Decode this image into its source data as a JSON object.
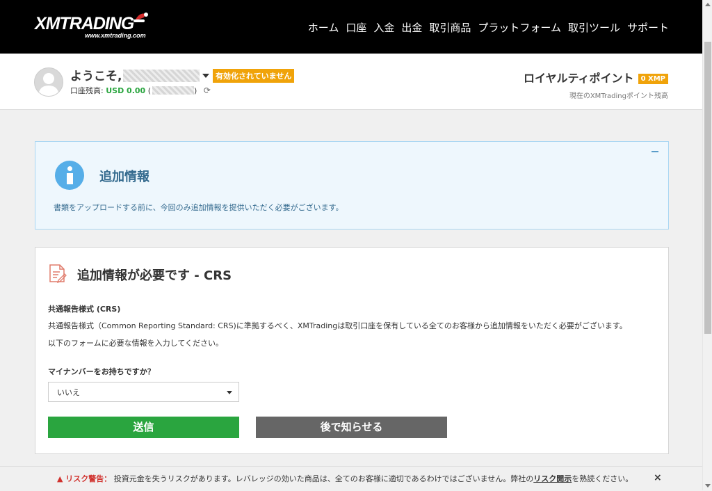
{
  "header": {
    "logo_text": "XMTRADING",
    "logo_sub": "www.xmtrading.com",
    "nav": [
      "ホーム",
      "口座",
      "入金",
      "出金",
      "取引商品",
      "プラットフォーム",
      "取引ツール",
      "サポート"
    ]
  },
  "user": {
    "welcome": "ようこそ,",
    "status_badge": "有効化されていません",
    "balance_label": "口座残高:",
    "balance_value": "USD 0.00",
    "balance_paren_open": "(",
    "balance_paren_close": ")"
  },
  "loyalty": {
    "title": "ロイヤルティポイント",
    "points": "0 XMP",
    "subtitle": "現在のXMTradingポイント残高"
  },
  "info": {
    "title": "追加情報",
    "text": "書類をアップロードする前に、今回のみ追加情報を提供いただく必要がございます。"
  },
  "form": {
    "title": "追加情報が必要です - CRS",
    "crs_heading": "共通報告様式 (CRS)",
    "crs_paragraph1": "共通報告様式（Common Reporting Standard: CRS)に準拠するべく、XMTradingは取引口座を保有している全てのお客様から追加情報をいただく必要がございます。",
    "crs_paragraph2": "以下のフォームに必要な情報を入力してください。",
    "question": "マイナンバーをお持ちですか？",
    "select_value": "いいえ",
    "submit_label": "送信",
    "later_label": "後で知らせる"
  },
  "risk": {
    "label": "▲ リスク警告：",
    "text": " 投資元金を失うリスクがあります。レバレッジの効いた商品は、全てのお客様に適切であるわけではございません。弊社の",
    "link": "リスク開示",
    "tail": "を熟読ください。",
    "close": "×"
  },
  "colors": {
    "topbar": "#000000",
    "badge": "#f0a30a",
    "submit": "#2aa53f",
    "later": "#666666",
    "info_bg": "#eef7fd",
    "info_accent": "#56aee8"
  }
}
